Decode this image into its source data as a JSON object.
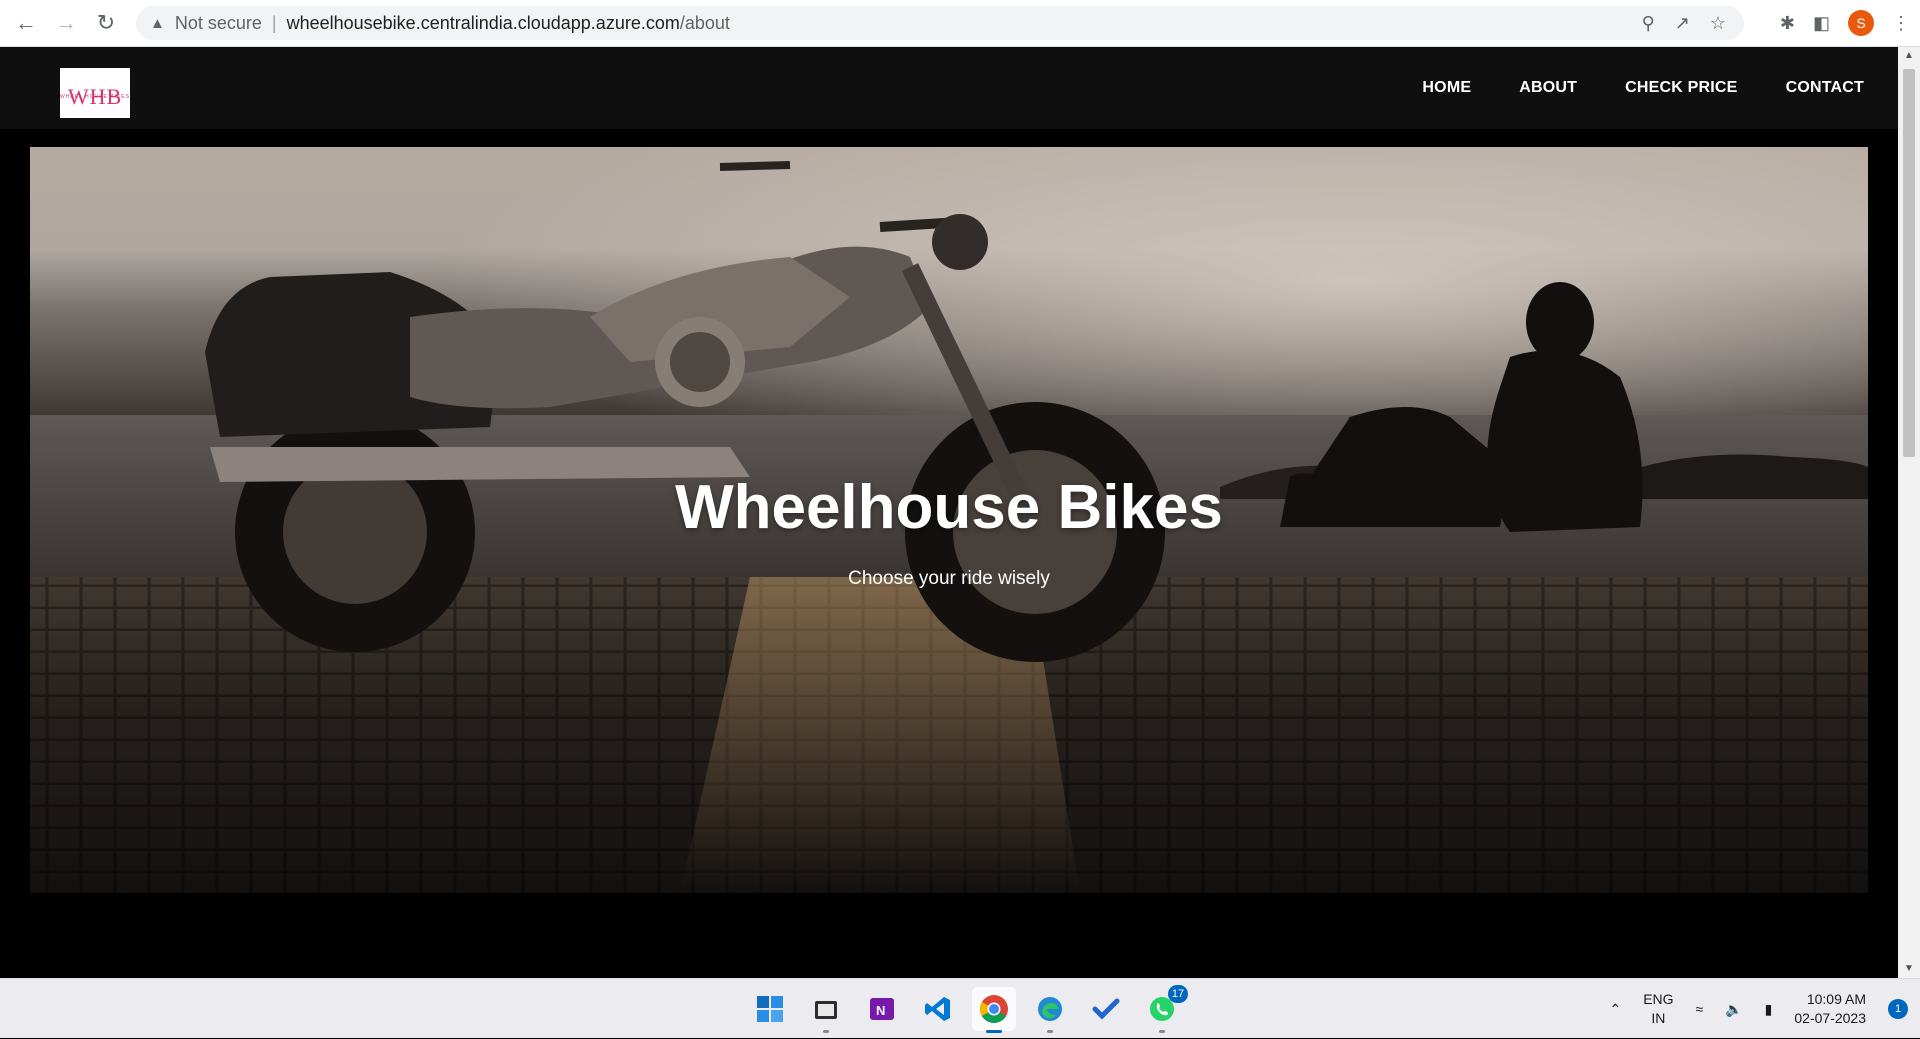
{
  "browser": {
    "security_label": "Not secure",
    "url_host": "wheelhousebike.centralindia.cloudapp.azure.com",
    "url_path": "/about",
    "profile_initial": "S"
  },
  "site": {
    "logo_text": "WHB",
    "logo_tagline": "WHEEL HOUSE BIKES",
    "nav": [
      "HOME",
      "ABOUT",
      "CHECK PRICE",
      "CONTACT"
    ],
    "hero_title": "Wheelhouse Bikes",
    "hero_subtitle": "Choose your ride wisely"
  },
  "taskbar": {
    "apps": [
      "windows-start",
      "file-explorer",
      "onenote",
      "vscode",
      "chrome",
      "edge",
      "todo",
      "whatsapp"
    ],
    "whatsapp_badge": "17",
    "lang_top": "ENG",
    "lang_bottom": "IN",
    "time": "10:09 AM",
    "date": "02-07-2023",
    "notification_count": "1"
  }
}
